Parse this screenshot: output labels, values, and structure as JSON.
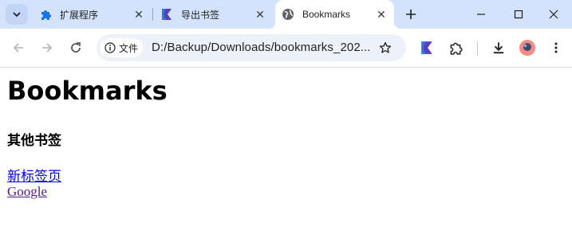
{
  "browser": {
    "tabs": [
      {
        "title": "扩展程序",
        "icon": "puzzle-icon",
        "active": false
      },
      {
        "title": "导出书签",
        "icon": "bookmark-flag-icon",
        "active": false
      },
      {
        "title": "Bookmarks",
        "icon": "globe-icon",
        "active": true
      }
    ],
    "address": {
      "chip_label": "文件",
      "url": "D:/Backup/Downloads/bookmarks_202..."
    },
    "colors": {
      "frame": "#d3e3fd",
      "omnibox": "#edf2fa",
      "avatar": "#f28b82"
    }
  },
  "page": {
    "title": "Bookmarks",
    "folder": "其他书签",
    "links": [
      {
        "text": "新标签页",
        "visited": false
      },
      {
        "text": "Google",
        "visited": true
      }
    ]
  }
}
